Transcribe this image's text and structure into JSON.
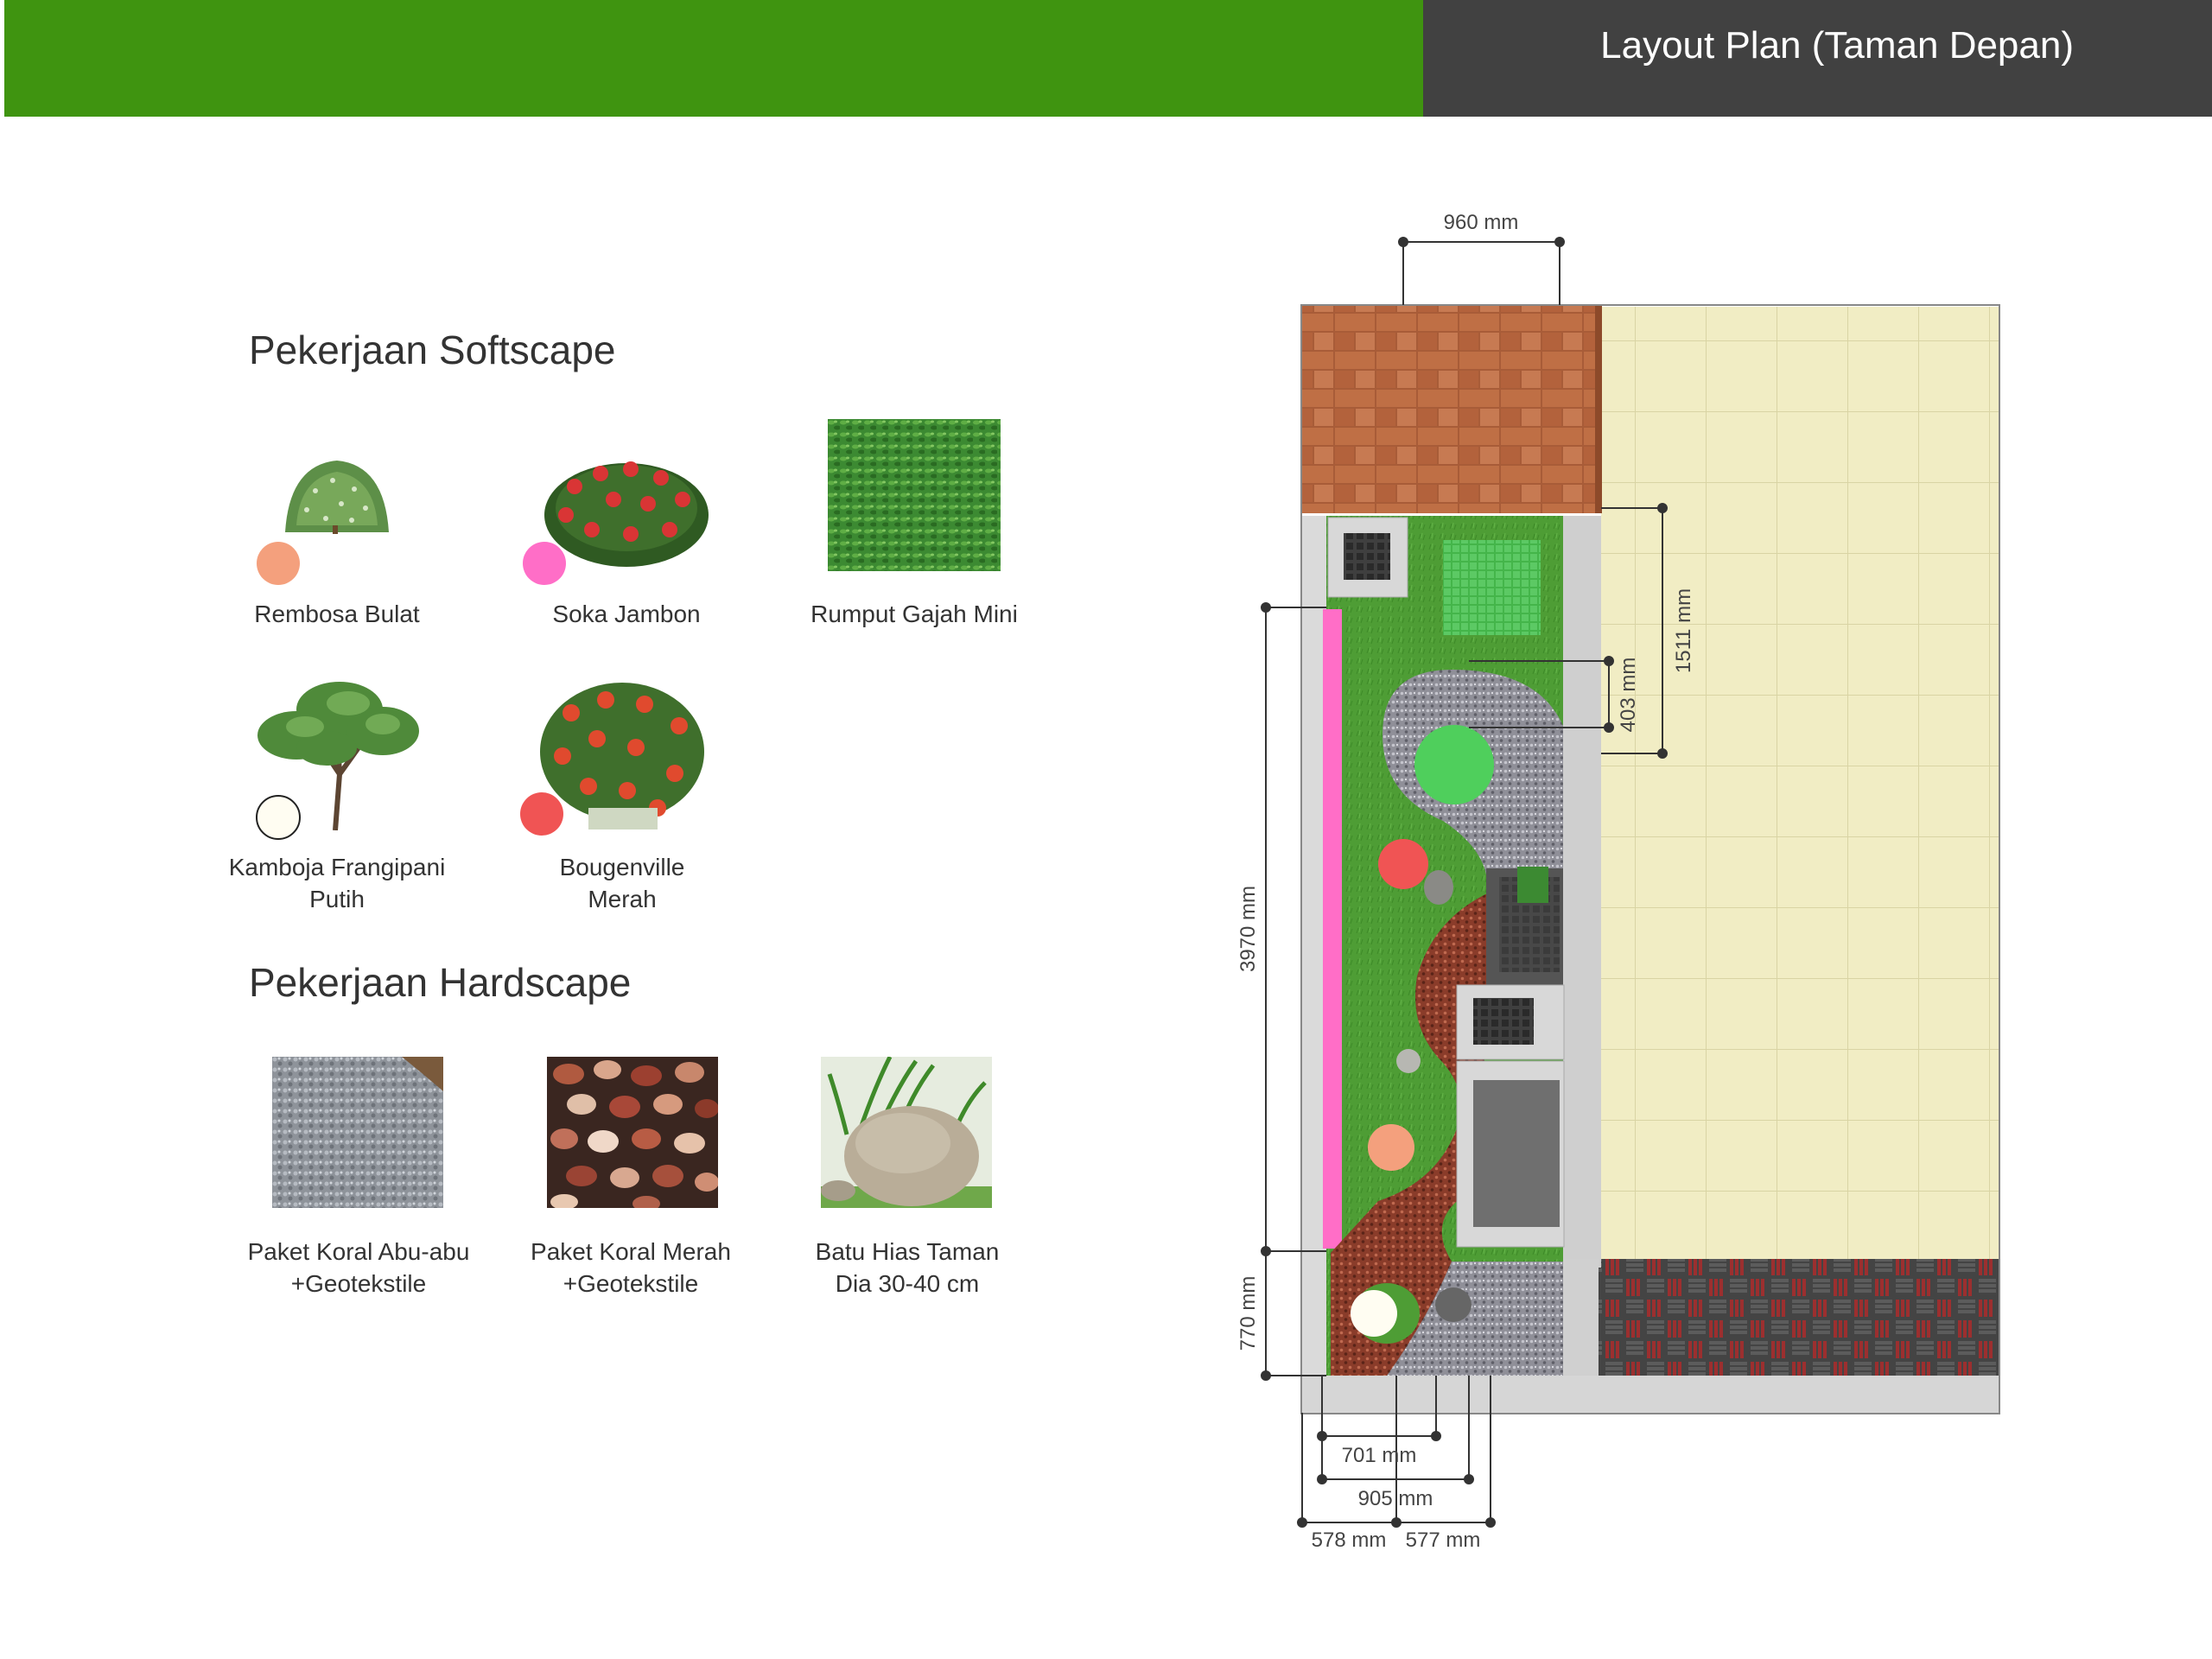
{
  "header": {
    "title": "Layout Plan (Taman Depan)"
  },
  "softscape": {
    "title": "Pekerjaan Softscape",
    "items": [
      {
        "label": "Rembosa Bulat",
        "icon": "round-shrub-icon",
        "marker_color": "#f4a07d"
      },
      {
        "label": "Soka Jambon",
        "icon": "flowering-shrub-icon",
        "marker_color": "#ff6ec7"
      },
      {
        "label": "Rumput Gajah Mini",
        "icon": "grass-texture-icon"
      },
      {
        "label_line1": "Kamboja Frangipani",
        "label_line2": "Putih",
        "icon": "frangipani-tree-icon",
        "marker_color": "#fffdf2"
      },
      {
        "label_line1": "Bougenville",
        "label_line2": "Merah",
        "icon": "bougainvillea-icon",
        "marker_color": "#f05454"
      }
    ]
  },
  "hardscape": {
    "title": "Pekerjaan Hardscape",
    "items": [
      {
        "label_line1": "Paket Koral Abu-abu",
        "label_line2": "+Geotekstile",
        "icon": "grey-gravel-icon"
      },
      {
        "label_line1": "Paket Koral Merah",
        "label_line2": "+Geotekstile",
        "icon": "red-pebbles-icon"
      },
      {
        "label_line1": "Batu Hias Taman",
        "label_line2": "Dia 30-40 cm",
        "icon": "garden-boulder-icon"
      }
    ]
  },
  "plan": {
    "dimensions": {
      "top_width": "960 mm",
      "right_length": "1511 mm",
      "inner_offset": "403 mm",
      "left_length": "3970 mm",
      "left_bottom": "770 mm",
      "bottom_1": "701 mm",
      "bottom_2": "905 mm",
      "bottom_3a": "578 mm",
      "bottom_3b": "577 mm"
    },
    "colors": {
      "grass": "#4e9d35",
      "tiles": "#f0ecc0",
      "roof_tile": "#b0643c",
      "pink_strip": "#ff6ec7",
      "grey_gravel": "#9c9ca4",
      "red_gravel": "#9c4a34"
    }
  }
}
